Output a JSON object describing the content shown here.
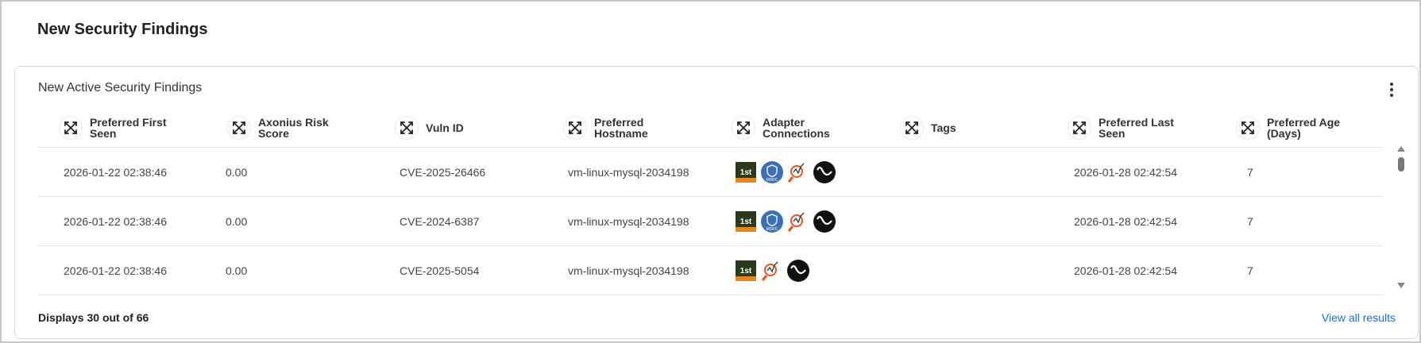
{
  "page": {
    "title": "New Security Findings"
  },
  "card": {
    "title": "New Active Security Findings",
    "menu_icon": "kebab-menu-icon"
  },
  "columns": [
    {
      "key": "first_seen",
      "label": "Preferred First Seen",
      "icon": "expand-arrows-icon"
    },
    {
      "key": "risk",
      "label": "Axonius Risk Score",
      "icon": "expand-arrows-icon"
    },
    {
      "key": "vuln_id",
      "label": "Vuln ID",
      "icon": "expand-arrows-icon"
    },
    {
      "key": "hostname",
      "label": "Preferred Hostname",
      "icon": "expand-arrows-icon"
    },
    {
      "key": "adapters",
      "label": "Adapter Connections",
      "icon": "expand-arrows-icon"
    },
    {
      "key": "tags",
      "label": "Tags",
      "icon": "expand-arrows-icon"
    },
    {
      "key": "last_seen",
      "label": "Preferred Last Seen",
      "icon": "expand-arrows-icon"
    },
    {
      "key": "age",
      "label": "Preferred Age (Days)",
      "icon": "expand-arrows-icon"
    }
  ],
  "rows": [
    {
      "first_seen": "2026-01-22 02:38:46",
      "risk": "0.00",
      "vuln_id": "CVE-2025-26466",
      "hostname": "vm-linux-mysql-2034198",
      "adapters": [
        "1st",
        "MSRC",
        "search",
        "wave"
      ],
      "tags": "",
      "last_seen": "2026-01-28 02:42:54",
      "age": "7"
    },
    {
      "first_seen": "2026-01-22 02:38:46",
      "risk": "0.00",
      "vuln_id": "CVE-2024-6387",
      "hostname": "vm-linux-mysql-2034198",
      "adapters": [
        "1st",
        "MSRC",
        "search",
        "wave"
      ],
      "tags": "",
      "last_seen": "2026-01-28 02:42:54",
      "age": "7"
    },
    {
      "first_seen": "2026-01-22 02:38:46",
      "risk": "0.00",
      "vuln_id": "CVE-2025-5054",
      "hostname": "vm-linux-mysql-2034198",
      "adapters": [
        "1st",
        "search",
        "wave"
      ],
      "tags": "",
      "last_seen": "2026-01-28 02:42:54",
      "age": "7"
    }
  ],
  "adapter_labels": {
    "first": "1st",
    "msrc": "MSRC"
  },
  "footer": {
    "count_text": "Displays 30 out of 66",
    "view_all_label": "View all results"
  },
  "colors": {
    "link": "#1f6fc5",
    "msrc_blue": "#3d6fb5",
    "search_orange": "#e8541e",
    "first_green": "#2a3a1c"
  }
}
